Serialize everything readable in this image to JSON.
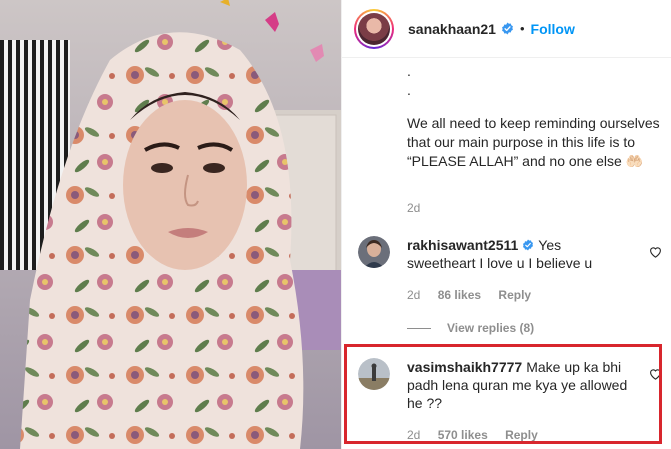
{
  "header": {
    "username": "sanakhaan21",
    "separator": "•",
    "follow_label": "Follow"
  },
  "caption": {
    "dots": [
      ".",
      "."
    ],
    "text": "We all need to keep reminding ourselves that our main purpose in this life is to “PLEASE ALLAH” and no one else 🤲🏻",
    "time": "2d"
  },
  "comments": [
    {
      "username": "rakhisawant2511",
      "verified": true,
      "text": "Yes sweetheart I love u I believe u",
      "time": "2d",
      "likes": "86 likes",
      "reply_label": "Reply"
    },
    {
      "username": "vasimshaikh7777",
      "verified": false,
      "text": "Make up ka bhi padh lena quran me kya ye allowed he ??",
      "time": "2d",
      "likes": "570 likes",
      "reply_label": "Reply"
    }
  ],
  "view_replies_label": "View replies (8)",
  "colors": {
    "accent": "#0095f6",
    "highlight": "#d8262d",
    "muted": "#8e8e8e"
  },
  "icons": [
    "verified-badge-icon",
    "heart-icon"
  ]
}
